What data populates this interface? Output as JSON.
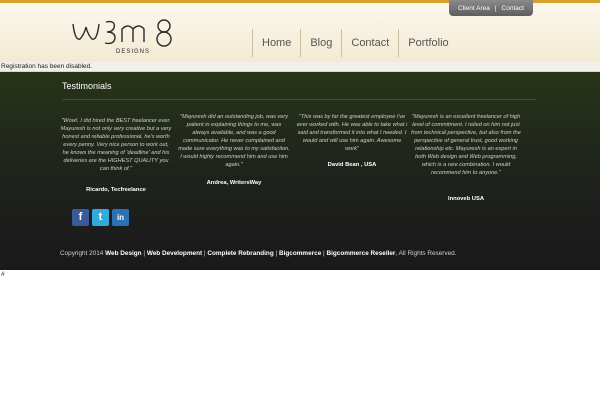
{
  "brand": {
    "logo_text": "DESIGNS"
  },
  "top_links": [
    "Client Area",
    "Contact"
  ],
  "top_links_separator": "|",
  "nav": [
    "Home",
    "Blog",
    "Contact",
    "Portfolio"
  ],
  "notice": "Registration has been disabled.",
  "testimonials": {
    "title": "Testimonials",
    "items": [
      {
        "quote": "\"Wow!, I did hired the BEST freelancer ever. Mayuresh is not only very creative but a very honest and reliable professional, he's worth every penny. Very nice person to work out, he knows the meaning of 'deadline' and his deliveries are the HIGHEST QUALITY you can think of.\"",
        "author": "Ricardo, Tecfreelance"
      },
      {
        "quote": "\"Mayuresh did an outstanding job, was very patient in explaining things to me, was always available, and was a good communicator. He never complained and made sure everything was to my satisfaction. I would highly recommend him and use him again.\"",
        "author": "Andrea, WritersWay"
      },
      {
        "quote": "\"This was by far the greatest employee i've ever worked with. He was able to take what i said and transformed it into what I needed. I would and will use him again. Awesome work\"",
        "author": "David Bean , USA"
      },
      {
        "quote": "\"Mayuresh is an excellent freelancer of high level of commitment. I relied on him not just from technical perspective, but also from the perspective of general trust, good working relationship etc. Mayuresh is an expert in both Web design and Web programming, which is a rare combination. I would recommend him to anyone.\"",
        "author": "Innoveb USA"
      }
    ]
  },
  "social": [
    {
      "icon": "facebook-icon",
      "glyph": "f",
      "color": "#3b5998"
    },
    {
      "icon": "twitter-icon",
      "glyph": "t",
      "color": "#33aadd"
    },
    {
      "icon": "linkedin-icon",
      "glyph": "in",
      "color": "#2a72b5"
    }
  ],
  "footer": {
    "prefix": "Copyright 2014",
    "links": [
      "Web Design",
      "Web Development",
      "Complete Rebranding",
      "Bigcommerce",
      "Bigcommerce Reseller"
    ],
    "separator": "|",
    "suffix": ", All Rights Reserved."
  },
  "stray_text": "#",
  "colors": {
    "accent_bar": "#d4a22c",
    "header_bg": "#f6eed9",
    "footer_bg": "#1a1a1a"
  }
}
